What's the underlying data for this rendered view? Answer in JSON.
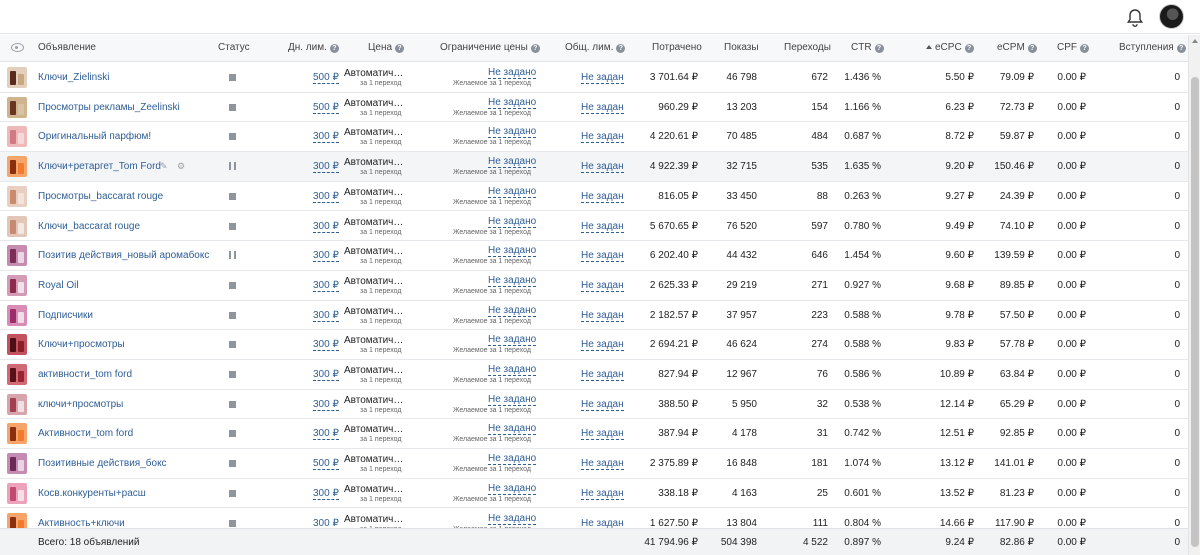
{
  "header": {
    "icons": [
      "bell-icon",
      "user-avatar"
    ],
    "columns": {
      "ad": "Объявление",
      "status": "Статус",
      "day_limit": "Дн. лим.",
      "price": "Цена",
      "price_limit": "Ограничение цены",
      "total_limit": "Общ. лим.",
      "spent": "Потрачено",
      "shows": "Показы",
      "clicks": "Переходы",
      "ctr": "CTR",
      "ecpc": "eCPC",
      "ecpm": "eCPM",
      "cpf": "CPF",
      "joins": "Вступления"
    }
  },
  "rows": [
    {
      "name": "Ключи_Zielinski",
      "status": "stopped",
      "day_limit": "500 ₽",
      "price": "Автоматич…",
      "price_sub": "за 1 переход",
      "price_limit": "Не задано",
      "price_limit_sub": "Желаемое за 1 переход",
      "total_limit": "Не задан",
      "spent": "3 701.64 ₽",
      "shows": "46 798",
      "clicks": "672",
      "ctr": "1.436 %",
      "ecpc": "5.50 ₽",
      "ecpm": "79.09 ₽",
      "cpf": "0.00 ₽",
      "joins": "0",
      "thumb": [
        "#c8a882",
        "#5a2a1c",
        "#e2d0bc"
      ]
    },
    {
      "name": "Просмотры рекламы_Zeelinski",
      "status": "stopped",
      "day_limit": "500 ₽",
      "price": "Автоматич…",
      "price_sub": "за 1 переход",
      "price_limit": "Не задано",
      "price_limit_sub": "Желаемое за 1 переход",
      "total_limit": "Не задан",
      "spent": "960.29 ₽",
      "shows": "13 203",
      "clicks": "154",
      "ctr": "1.166 %",
      "ecpc": "6.23 ₽",
      "ecpm": "72.73 ₽",
      "cpf": "0.00 ₽",
      "joins": "0",
      "thumb": [
        "#d9c3a5",
        "#6b3422",
        "#cfb48e"
      ]
    },
    {
      "name": "Оригинальный парфюм!",
      "status": "stopped",
      "day_limit": "300 ₽",
      "price": "Автоматич…",
      "price_sub": "за 1 переход",
      "price_limit": "Не задано",
      "price_limit_sub": "Желаемое за 1 переход",
      "total_limit": "Не задан",
      "spent": "4 220.61 ₽",
      "shows": "70 485",
      "clicks": "484",
      "ctr": "0.687 %",
      "ecpc": "8.72 ₽",
      "ecpm": "59.87 ₽",
      "cpf": "0.00 ₽",
      "joins": "0",
      "thumb": [
        "#f3d9d9",
        "#d07a86",
        "#f0b9b9"
      ]
    },
    {
      "name": "Ключи+ретаргет_Tom Ford",
      "status": "paused",
      "day_limit": "300 ₽",
      "price": "Автоматич…",
      "price_sub": "за 1 переход",
      "price_limit": "Не задано",
      "price_limit_sub": "Желаемое за 1 переход",
      "total_limit": "Не задан",
      "spent": "4 922.39 ₽",
      "shows": "32 715",
      "clicks": "535",
      "ctr": "1.635 %",
      "ecpc": "9.20 ₽",
      "ecpm": "150.46 ₽",
      "cpf": "0.00 ₽",
      "joins": "0",
      "thumb": [
        "#f07a2e",
        "#8a2e10",
        "#f5a46a"
      ],
      "hl": true
    },
    {
      "name": "Просмотры_baccarat rouge",
      "status": "stopped",
      "day_limit": "300 ₽",
      "price": "Автоматич…",
      "price_sub": "за 1 переход",
      "price_limit": "Не задано",
      "price_limit_sub": "Желаемое за 1 переход",
      "total_limit": "Не задан",
      "spent": "816.05 ₽",
      "shows": "33 450",
      "clicks": "88",
      "ctr": "0.263 %",
      "ecpc": "9.27 ₽",
      "ecpm": "24.39 ₽",
      "cpf": "0.00 ₽",
      "joins": "0",
      "thumb": [
        "#f2e4dc",
        "#c98a6e",
        "#e8cfc2"
      ]
    },
    {
      "name": "Ключи_baccarat rouge",
      "status": "stopped",
      "day_limit": "300 ₽",
      "price": "Автоматич…",
      "price_sub": "за 1 переход",
      "price_limit": "Не задано",
      "price_limit_sub": "Желаемое за 1 переход",
      "total_limit": "Не задан",
      "spent": "5 670.65 ₽",
      "shows": "76 520",
      "clicks": "597",
      "ctr": "0.780 %",
      "ecpc": "9.49 ₽",
      "ecpm": "74.10 ₽",
      "cpf": "0.00 ₽",
      "joins": "0",
      "thumb": [
        "#f4e8e2",
        "#c48a72",
        "#e2c6b8"
      ]
    },
    {
      "name": "Позитив действия_новый аромабокс",
      "status": "paused",
      "day_limit": "300 ₽",
      "price": "Автоматич…",
      "price_sub": "за 1 переход",
      "price_limit": "Не задано",
      "price_limit_sub": "Желаемое за 1 переход",
      "total_limit": "Не задан",
      "spent": "6 202.40 ₽",
      "shows": "44 432",
      "clicks": "646",
      "ctr": "1.454 %",
      "ecpc": "9.60 ₽",
      "ecpm": "139.59 ₽",
      "cpf": "0.00 ₽",
      "joins": "0",
      "thumb": [
        "#ead6e4",
        "#7a2f5a",
        "#c88bb0"
      ]
    },
    {
      "name": "Royal Oil",
      "status": "stopped",
      "day_limit": "300 ₽",
      "price": "Автоматич…",
      "price_sub": "за 1 переход",
      "price_limit": "Не задано",
      "price_limit_sub": "Желаемое за 1 переход",
      "total_limit": "Не задан",
      "spent": "2 625.33 ₽",
      "shows": "29 219",
      "clicks": "271",
      "ctr": "0.927 %",
      "ecpc": "9.68 ₽",
      "ecpm": "89.85 ₽",
      "cpf": "0.00 ₽",
      "joins": "0",
      "thumb": [
        "#efe2ea",
        "#8a2b4e",
        "#d49bb6"
      ]
    },
    {
      "name": "Подписчики",
      "status": "stopped",
      "day_limit": "300 ₽",
      "price": "Автоматич…",
      "price_sub": "за 1 переход",
      "price_limit": "Не задано",
      "price_limit_sub": "Желаемое за 1 переход",
      "total_limit": "Не задан",
      "spent": "2 182.57 ₽",
      "shows": "37 957",
      "clicks": "223",
      "ctr": "0.588 %",
      "ecpc": "9.78 ₽",
      "ecpm": "57.50 ₽",
      "cpf": "0.00 ₽",
      "joins": "0",
      "thumb": [
        "#f1dde8",
        "#9b2e6a",
        "#d98cb6"
      ]
    },
    {
      "name": "Ключи+просмотры",
      "status": "stopped",
      "day_limit": "300 ₽",
      "price": "Автоматич…",
      "price_sub": "за 1 переход",
      "price_limit": "Не задано",
      "price_limit_sub": "Желаемое за 1 переход",
      "total_limit": "Не задан",
      "spent": "2 694.21 ₽",
      "shows": "46 624",
      "clicks": "274",
      "ctr": "0.588 %",
      "ecpc": "9.83 ₽",
      "ecpm": "57.78 ₽",
      "cpf": "0.00 ₽",
      "joins": "0",
      "thumb": [
        "#8a1f2a",
        "#4d0e16",
        "#c2525e"
      ]
    },
    {
      "name": "активности_tom ford",
      "status": "stopped",
      "day_limit": "300 ₽",
      "price": "Автоматич…",
      "price_sub": "за 1 переход",
      "price_limit": "Не задано",
      "price_limit_sub": "Желаемое за 1 переход",
      "total_limit": "Не задан",
      "spent": "827.94 ₽",
      "shows": "12 967",
      "clicks": "76",
      "ctr": "0.586 %",
      "ecpc": "10.89 ₽",
      "ecpm": "63.84 ₽",
      "cpf": "0.00 ₽",
      "joins": "0",
      "thumb": [
        "#9a2430",
        "#5a1018",
        "#d06a74"
      ]
    },
    {
      "name": "ключи+просмотры",
      "status": "stopped",
      "day_limit": "300 ₽",
      "price": "Автоматич…",
      "price_sub": "за 1 переход",
      "price_limit": "Не задано",
      "price_limit_sub": "Желаемое за 1 переход",
      "total_limit": "Не задан",
      "spent": "388.50 ₽",
      "shows": "5 950",
      "clicks": "32",
      "ctr": "0.538 %",
      "ecpc": "12.14 ₽",
      "ecpm": "65.29 ₽",
      "cpf": "0.00 ₽",
      "joins": "0",
      "thumb": [
        "#f0e0e2",
        "#a04050",
        "#d8a4ac"
      ]
    },
    {
      "name": "Активности_tom ford",
      "status": "stopped",
      "day_limit": "300 ₽",
      "price": "Автоматич…",
      "price_sub": "за 1 переход",
      "price_limit": "Не задано",
      "price_limit_sub": "Желаемое за 1 переход",
      "total_limit": "Не задан",
      "spent": "387.94 ₽",
      "shows": "4 178",
      "clicks": "31",
      "ctr": "0.742 %",
      "ecpc": "12.51 ₽",
      "ecpm": "92.85 ₽",
      "cpf": "0.00 ₽",
      "joins": "0",
      "thumb": [
        "#f07a2e",
        "#8a2e10",
        "#f5a46a"
      ]
    },
    {
      "name": "Позитивные действия_бокс",
      "status": "stopped",
      "day_limit": "500 ₽",
      "price": "Автоматич…",
      "price_sub": "за 1 переход",
      "price_limit": "Не задано",
      "price_limit_sub": "Желаемое за 1 переход",
      "total_limit": "Не задан",
      "spent": "2 375.89 ₽",
      "shows": "16 848",
      "clicks": "181",
      "ctr": "1.074 %",
      "ecpc": "13.12 ₽",
      "ecpm": "141.01 ₽",
      "cpf": "0.00 ₽",
      "joins": "0",
      "thumb": [
        "#e8d4e2",
        "#6e2a56",
        "#c48cb2"
      ]
    },
    {
      "name": "Косв.конкуренты+расш",
      "status": "stopped",
      "day_limit": "300 ₽",
      "price": "Автоматич…",
      "price_sub": "за 1 переход",
      "price_limit": "Не задано",
      "price_limit_sub": "Желаемое за 1 переход",
      "total_limit": "Не задан",
      "spent": "338.18 ₽",
      "shows": "4 163",
      "clicks": "25",
      "ctr": "0.601 %",
      "ecpc": "13.52 ₽",
      "ecpm": "81.23 ₽",
      "cpf": "0.00 ₽",
      "joins": "0",
      "thumb": [
        "#f6dfe6",
        "#c24a70",
        "#eca2ba"
      ]
    },
    {
      "name": "Активность+ключи",
      "status": "stopped",
      "day_limit": "300 ₽",
      "price": "Автоматич…",
      "price_sub": "за 1 переход",
      "price_limit": "Не задано",
      "price_limit_sub": "Желаемое за 1 переход",
      "total_limit": "Не задан",
      "spent": "1 627.50 ₽",
      "shows": "13 804",
      "clicks": "111",
      "ctr": "0.804 %",
      "ecpc": "14.66 ₽",
      "ecpm": "117.90 ₽",
      "cpf": "0.00 ₽",
      "joins": "0",
      "thumb": [
        "#f07a2e",
        "#8a2e10",
        "#f5a46a"
      ]
    }
  ],
  "footer": {
    "total_label": "Всего: 18 объявлений",
    "spent": "41 794.96 ₽",
    "shows": "504 398",
    "clicks": "4 522",
    "ctr": "0.897 %",
    "ecpc": "9.24 ₽",
    "ecpm": "82.86 ₽",
    "cpf": "0.00 ₽",
    "joins": "0"
  },
  "colors": {
    "link": "#2f5e96",
    "header_bg": "#f7f8fa",
    "highlight_row": "#f4f5f7"
  }
}
